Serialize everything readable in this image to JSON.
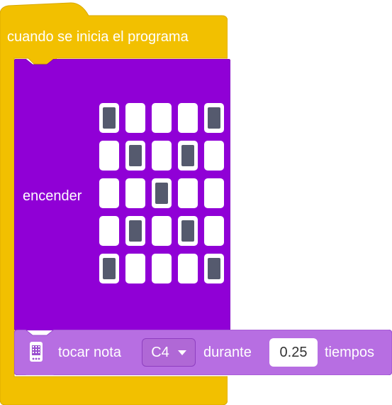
{
  "start_block": {
    "label": "cuando se inicia el programa",
    "color": "#f2c000"
  },
  "show_leds_block": {
    "label": "encender",
    "color": "#9000d6",
    "leds": [
      [
        1,
        0,
        0,
        0,
        1
      ],
      [
        0,
        1,
        0,
        1,
        0
      ],
      [
        0,
        0,
        1,
        0,
        0
      ],
      [
        0,
        1,
        0,
        1,
        0
      ],
      [
        1,
        0,
        0,
        0,
        1
      ]
    ]
  },
  "tone_block": {
    "icon": "microbit-icon",
    "label_play": "tocar nota",
    "note": "C4",
    "label_for": "durante",
    "beats": "0.25",
    "label_beats": "tiempos",
    "color": "#b76ee2"
  }
}
